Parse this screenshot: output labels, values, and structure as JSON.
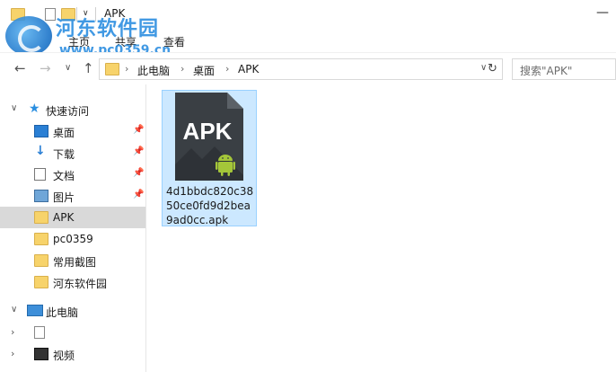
{
  "window": {
    "title": "APK",
    "minimize_glyph": "—"
  },
  "watermark": {
    "brand": "河东软件园",
    "url": "www.pc0359.cn"
  },
  "ribbon": {
    "tabs": [
      "主页",
      "共享",
      "查看"
    ]
  },
  "toolbar": {
    "back_icon": "←",
    "forward_icon": "→",
    "recent_icon": "∨",
    "up_icon": "↑",
    "refresh_icon": "↻",
    "dropdown_icon": "∨",
    "crumb_separator": "›"
  },
  "address": {
    "crumbs": [
      "此电脑",
      "桌面",
      "APK"
    ]
  },
  "search": {
    "placeholder": "搜索\"APK\""
  },
  "nav_pane": {
    "quick_access": "快速访问",
    "items": [
      {
        "label": "桌面",
        "icon": "desktop-icon",
        "pinned": true
      },
      {
        "label": "下载",
        "icon": "download-icon",
        "pinned": true
      },
      {
        "label": "文档",
        "icon": "documents-icon",
        "pinned": true
      },
      {
        "label": "图片",
        "icon": "pictures-icon",
        "pinned": true
      },
      {
        "label": "APK",
        "icon": "folder-icon",
        "selected": true
      },
      {
        "label": "pc0359",
        "icon": "folder-icon"
      },
      {
        "label": "常用截图",
        "icon": "folder-icon"
      },
      {
        "label": "河东软件园",
        "icon": "folder-icon"
      }
    ],
    "this_pc": "此电脑",
    "pc_children": [
      {
        "label": "",
        "icon": "file-icon"
      },
      {
        "label": "视频",
        "icon": "video-icon"
      }
    ],
    "pin_glyph": "📌"
  },
  "files": [
    {
      "name": "4d1bbdc820c3850ce0fd9d2bea9ad0cc.apk",
      "icon_label": "APK",
      "selected": true
    }
  ],
  "colors": {
    "selection_bg": "#cce8ff",
    "selection_border": "#99d1ff",
    "android_green": "#a4c639",
    "apk_icon_bg": "#3a3f44"
  }
}
